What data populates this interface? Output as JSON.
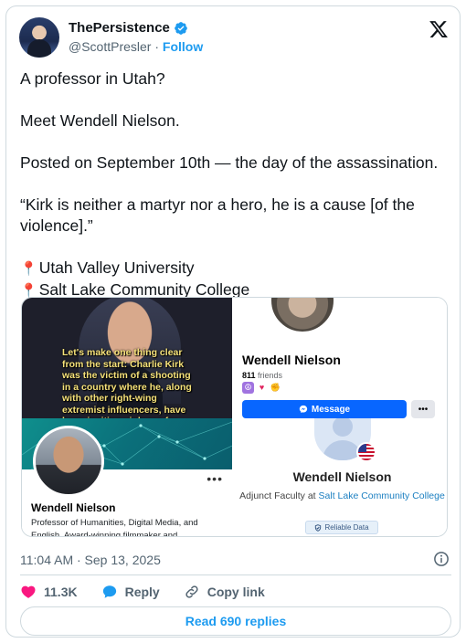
{
  "author": {
    "display_name": "ThePersistence",
    "handle": "@ScottPresler",
    "separator": " · ",
    "follow_label": "Follow"
  },
  "tweet": {
    "lines": [
      "A professor in Utah?",
      "Meet Wendell Nielson.",
      "Posted on September 10th — the day of the assassination.",
      "“Kirk is neither a martyr nor a hero, he is a cause [of the violence].”",
      "Utah Valley University",
      "Salt Lake Community College"
    ],
    "pin_glyph": "📍"
  },
  "media": {
    "video_caption": "Let's make one thing clear from the start: Charlie Kirk was the victim of a shooting in a country where he, along with other right-wing extremist influencers, have been inciting violence for years. Kirk is",
    "facebook": {
      "name": "Wendell Nielson",
      "friends_count": "811",
      "friends_label": " friends",
      "message_label": "Message",
      "more_label": "•••"
    },
    "linkedin": {
      "name": "Wendell Nielson",
      "headline": "Professor of Humanities, Digital Media, and English. Award-winning filmmaker and",
      "more_label": "•••"
    },
    "directory": {
      "name": "Wendell Nielson",
      "role_prefix": "Adjunct Faculty at ",
      "role_link": "Salt Lake Community College",
      "badge_label": "Reliable Data"
    }
  },
  "meta": {
    "timestamp": "11:04 AM · Sep 13, 2025"
  },
  "actions": {
    "likes": "11.3K",
    "reply_label": "Reply",
    "copy_link_label": "Copy link"
  },
  "footer": {
    "read_replies_label": "Read 690 replies"
  },
  "colors": {
    "accent": "#1d9bf0",
    "like": "#f91880",
    "text": "#0f1419",
    "muted": "#536471",
    "border": "#cfd9de",
    "facebook_blue": "#0866ff"
  }
}
